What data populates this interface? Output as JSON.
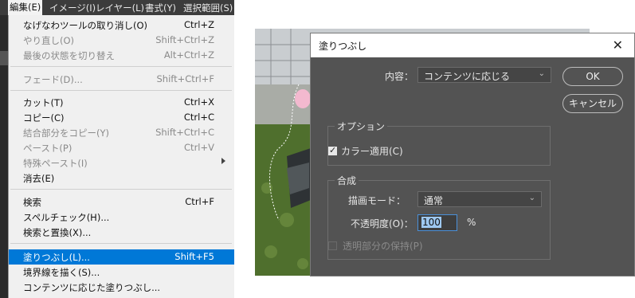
{
  "menubar": {
    "items": [
      "編集(E)",
      "イメージ(I)",
      "レイヤー(L)",
      "書式(Y)",
      "選択範囲(S)"
    ]
  },
  "edit_menu": {
    "items": [
      {
        "label": "なげなわツールの取り消し(O)",
        "shortcut": "Ctrl+Z",
        "enabled": true
      },
      {
        "label": "やり直し(O)",
        "shortcut": "Shift+Ctrl+Z",
        "enabled": false
      },
      {
        "label": "最後の状態を切り替え",
        "shortcut": "Alt+Ctrl+Z",
        "enabled": false
      },
      {
        "label": "フェード(D)...",
        "shortcut": "Shift+Ctrl+F",
        "enabled": false
      },
      {
        "label": "カット(T)",
        "shortcut": "Ctrl+X",
        "enabled": true
      },
      {
        "label": "コピー(C)",
        "shortcut": "Ctrl+C",
        "enabled": true
      },
      {
        "label": "結合部分をコピー(Y)",
        "shortcut": "Shift+Ctrl+C",
        "enabled": false
      },
      {
        "label": "ペースト(P)",
        "shortcut": "Ctrl+V",
        "enabled": false
      },
      {
        "label": "特殊ペースト(I)",
        "shortcut": "",
        "enabled": false
      },
      {
        "label": "消去(E)",
        "shortcut": "",
        "enabled": true
      },
      {
        "label": "検索",
        "shortcut": "Ctrl+F",
        "enabled": true
      },
      {
        "label": "スペルチェック(H)...",
        "shortcut": "",
        "enabled": true
      },
      {
        "label": "検索と置換(X)...",
        "shortcut": "",
        "enabled": true
      },
      {
        "label": "塗りつぶし(L)...",
        "shortcut": "Shift+F5",
        "enabled": true,
        "highlighted": true
      },
      {
        "label": "境界線を描く(S)...",
        "shortcut": "",
        "enabled": true
      },
      {
        "label": "コンテンツに応じた塗りつぶし...",
        "shortcut": "",
        "enabled": true
      }
    ]
  },
  "dialog": {
    "title": "塗りつぶし",
    "close_glyph": "✕",
    "content_label": "内容：",
    "content_value": "コンテンツに応じる",
    "ok_label": "OK",
    "cancel_label": "キャンセル",
    "options_title": "オプション",
    "color_adapt_label": "カラー適用(C)",
    "color_adapt_checked": true,
    "blend_title": "合成",
    "mode_label": "描画モード：",
    "mode_value": "通常",
    "opacity_label": "不透明度(O)：",
    "opacity_value": "100",
    "opacity_unit": "%",
    "preserve_label": "透明部分の保持(P)",
    "preserve_checked": false
  },
  "colors": {
    "highlight": "#0078d7",
    "dialog_bg": "#535353",
    "menu_bg": "#f0f0f0"
  }
}
